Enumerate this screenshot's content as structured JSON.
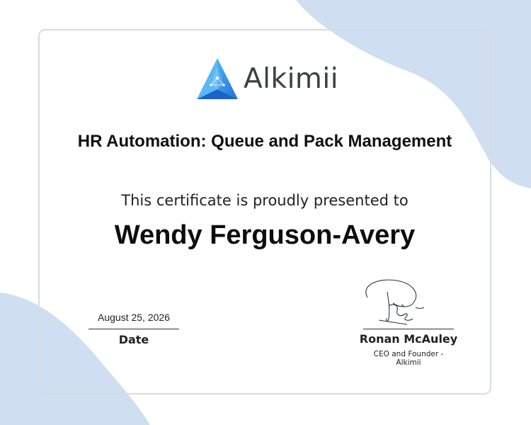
{
  "colors": {
    "accent_blue": "#2f8fe3",
    "background_shape": "#c9ddf2",
    "card_border": "#d7dbe1"
  },
  "logo": {
    "icon": "alkimii-triangle-logo-icon",
    "text": "Alkimii"
  },
  "certificate": {
    "course_title": "HR Automation: Queue and Pack Management",
    "presented_text": "This certificate is proudly presented to",
    "recipient_name": "Wendy Ferguson-Avery"
  },
  "date_block": {
    "value": "August 25, 2026",
    "label": "Date"
  },
  "signature_block": {
    "name": "Ronan McAuley",
    "title_line1": "CEO and Founder -",
    "title_line2": "Alkimii"
  }
}
